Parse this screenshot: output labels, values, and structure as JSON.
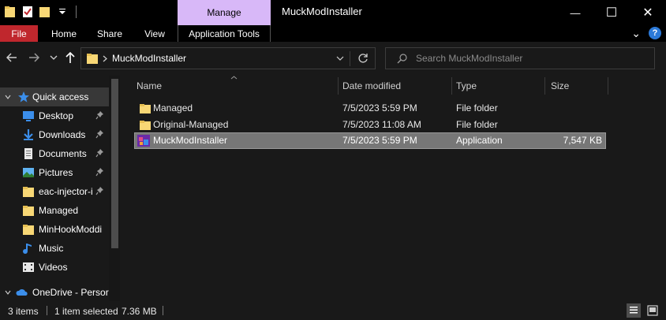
{
  "titlebar": {
    "manage_tab": "Manage",
    "window_title": "MuckModInstaller",
    "minimize_glyph": "—",
    "maximize_glyph": "☐",
    "close_glyph": "✕"
  },
  "ribbon": {
    "tabs": [
      "File",
      "Home",
      "Share",
      "View",
      "Application Tools"
    ],
    "expand_glyph": "⌄",
    "help_glyph": "?"
  },
  "addressbar": {
    "path_segment": "MuckModInstaller",
    "search_placeholder": "Search MuckModInstaller"
  },
  "sidebar": {
    "items": [
      {
        "label": "Quick access",
        "icon": "star-icon",
        "pinned": false,
        "active": true
      },
      {
        "label": "Desktop",
        "icon": "desktop-folder-icon",
        "pinned": true
      },
      {
        "label": "Downloads",
        "icon": "downloads-folder-icon",
        "pinned": true
      },
      {
        "label": "Documents",
        "icon": "documents-folder-icon",
        "pinned": true
      },
      {
        "label": "Pictures",
        "icon": "pictures-folder-icon",
        "pinned": true
      },
      {
        "label": "eac-injector-i",
        "icon": "folder-icon",
        "pinned": true
      },
      {
        "label": "Managed",
        "icon": "folder-icon",
        "pinned": false
      },
      {
        "label": "MinHookModdi",
        "icon": "folder-icon",
        "pinned": false
      },
      {
        "label": "Music",
        "icon": "music-folder-icon",
        "pinned": false
      },
      {
        "label": "Videos",
        "icon": "videos-folder-icon",
        "pinned": false
      },
      {
        "label": "OneDrive - Persor",
        "icon": "onedrive-icon",
        "pinned": false
      }
    ]
  },
  "filelist": {
    "columns": [
      "Name",
      "Date modified",
      "Type",
      "Size"
    ],
    "rows": [
      {
        "name": "Managed",
        "date": "7/5/2023 5:59 PM",
        "type": "File folder",
        "size": "",
        "icon": "folder-icon",
        "selected": false
      },
      {
        "name": "Original-Managed",
        "date": "7/5/2023 11:08 AM",
        "type": "File folder",
        "size": "",
        "icon": "folder-icon",
        "selected": false
      },
      {
        "name": "MuckModInstaller",
        "date": "7/5/2023 5:59 PM",
        "type": "Application",
        "size": "7,547 KB",
        "icon": "application-icon",
        "selected": true
      }
    ]
  },
  "statusbar": {
    "item_count": "3 items",
    "selection": "1 item selected",
    "selection_size": "7.36 MB"
  },
  "colors": {
    "background": "#191919",
    "manage_tab": "#d8b8f8",
    "file_tab": "#c0272d",
    "folder_yellow": "#f8d775",
    "selected_row": "#777777",
    "accent_blue": "#2b79d8"
  }
}
